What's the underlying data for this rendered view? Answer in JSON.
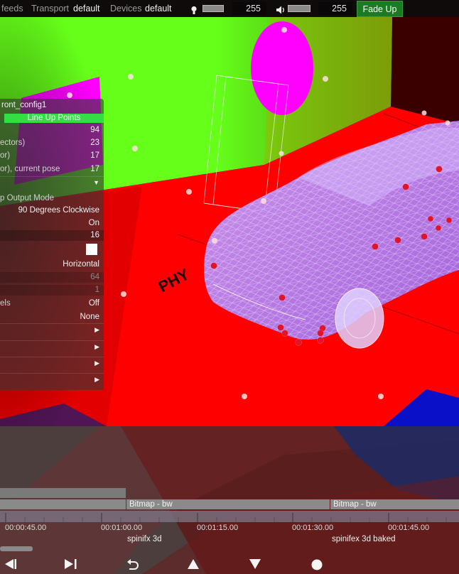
{
  "topbar": {
    "feeds_label": "feeds",
    "transport_label": "Transport",
    "transport_value": "default",
    "devices_label": "Devices",
    "devices_value": "default",
    "brightness_value": "255",
    "volume_value": "255",
    "fade_up_label": "Fade Up",
    "brightness_icon": "bulb-icon",
    "volume_icon": "speaker-icon"
  },
  "viewport": {
    "floor_text": "PHY",
    "colors": {
      "wall": "#66ff1a",
      "floor": "#ff0000",
      "disc": "#ff00ff",
      "car": "#b07aff"
    }
  },
  "panel": {
    "title": "ront_config1",
    "button": "Line Up Points",
    "rows": [
      {
        "key": "",
        "value": "94"
      },
      {
        "key": "ectors)",
        "value": "23"
      },
      {
        "key": "or)",
        "value": "17"
      },
      {
        "key": "or), current pose",
        "value": "17"
      }
    ],
    "output_mode_label": "p Output Mode",
    "output_mode_value": "90 Degrees Clockwise",
    "on_value": "On",
    "size_value": "16",
    "orientation_value": "Horizontal",
    "disabled_value_1": "64",
    "disabled_value_2": "1",
    "pixels_label": "els",
    "pixels_value": "Off",
    "none_value": "None"
  },
  "timeline": {
    "clips": [
      "Bitmap - bw",
      "Bitmap - bw"
    ],
    "times": [
      "00:00:45.00",
      "00:01:00.00",
      "00:01:15.00",
      "00:01:30.00",
      "00:01:45.00"
    ],
    "cues": [
      "spinifx 3d",
      "spinifex 3d baked"
    ]
  },
  "transport_icons": [
    "skip-back-icon",
    "skip-forward-icon",
    "loop-back-icon",
    "up-triangle-icon",
    "down-triangle-icon",
    "record-icon"
  ]
}
